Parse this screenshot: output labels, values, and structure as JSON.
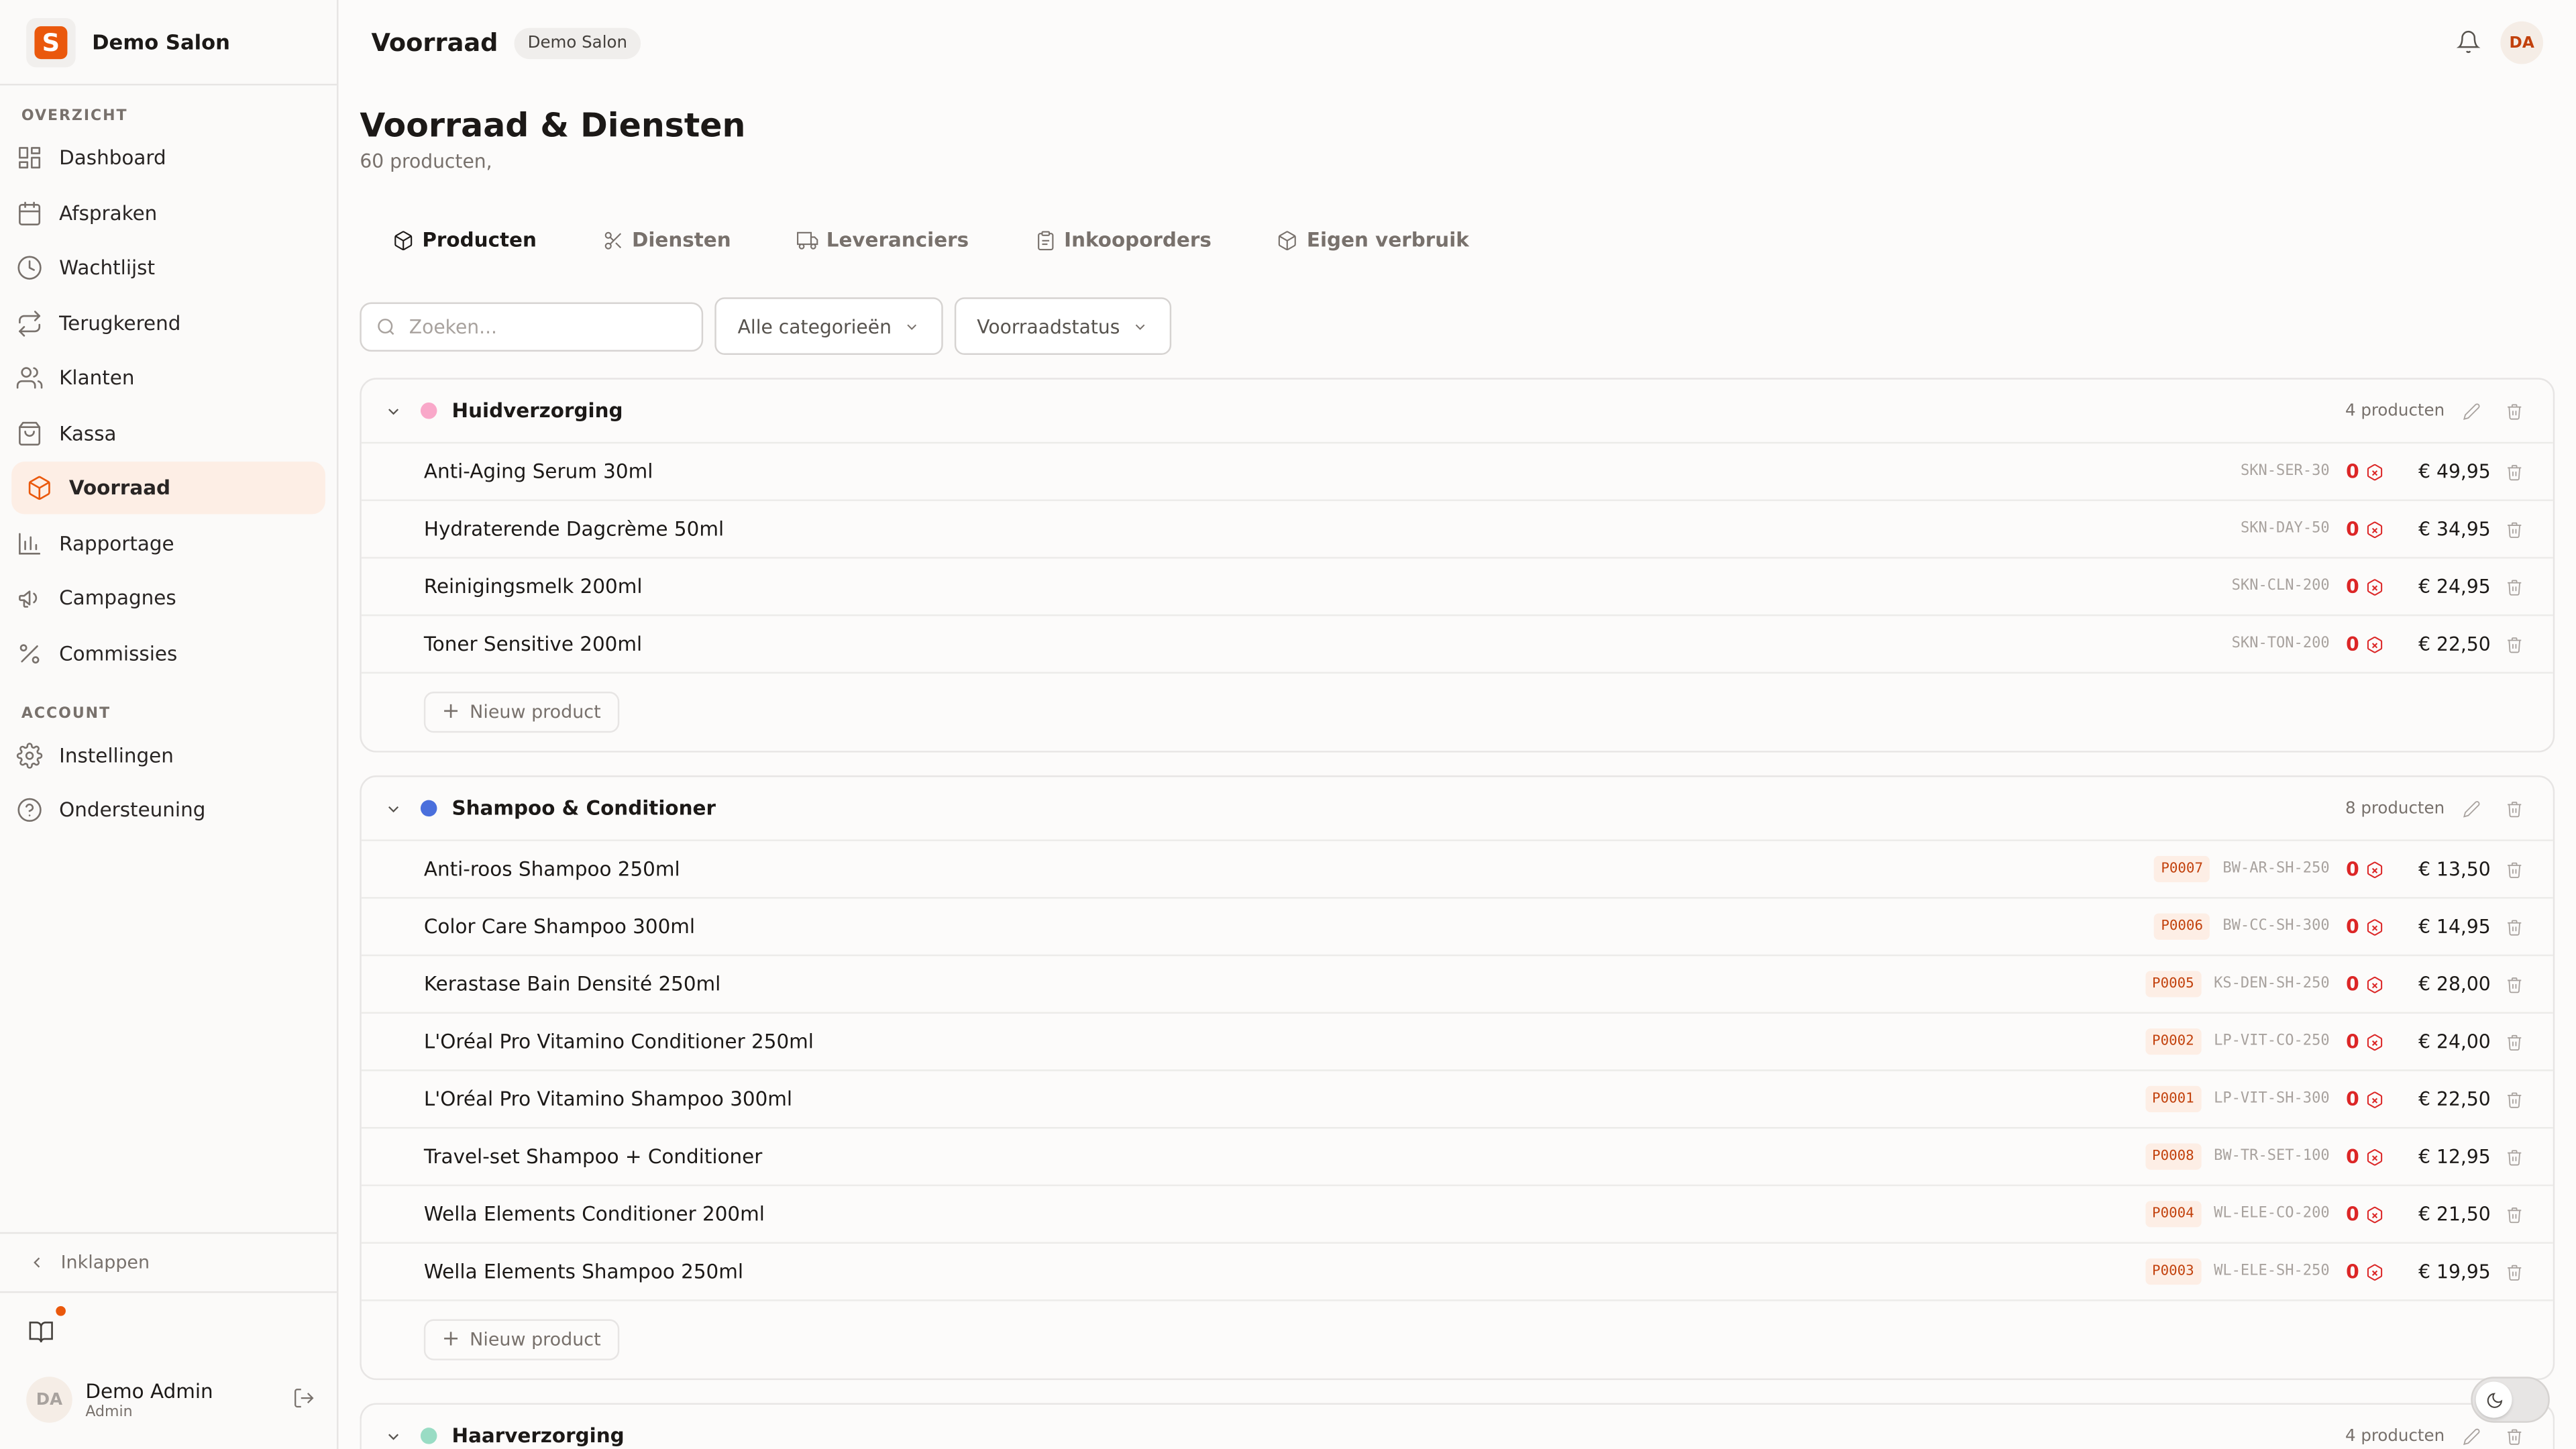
{
  "brand": {
    "logo_letter": "S",
    "name": "Demo Salon"
  },
  "sidebar": {
    "sections": [
      {
        "label": "OVERZICHT"
      },
      {
        "label": "ACCOUNT"
      }
    ],
    "items": [
      {
        "label": "Dashboard",
        "icon": "dashboard-icon"
      },
      {
        "label": "Afspraken",
        "icon": "calendar-icon"
      },
      {
        "label": "Wachtlijst",
        "icon": "clock-icon"
      },
      {
        "label": "Terugkerend",
        "icon": "repeat-icon"
      },
      {
        "label": "Klanten",
        "icon": "users-icon"
      },
      {
        "label": "Kassa",
        "icon": "shopping-bag-icon"
      },
      {
        "label": "Voorraad",
        "icon": "package-icon",
        "active": true
      },
      {
        "label": "Rapportage",
        "icon": "bar-chart-icon"
      },
      {
        "label": "Campagnes",
        "icon": "megaphone-icon"
      },
      {
        "label": "Commissies",
        "icon": "percent-icon"
      },
      {
        "label": "Instellingen",
        "icon": "gear-icon"
      },
      {
        "label": "Ondersteuning",
        "icon": "help-circle-icon"
      }
    ],
    "collapse_label": "Inklappen",
    "user": {
      "initials": "DA",
      "name": "Demo Admin",
      "role": "Admin"
    }
  },
  "header": {
    "title": "Voorraad",
    "badge": "Demo Salon",
    "avatar_initials": "DA"
  },
  "page": {
    "title": "Voorraad & Diensten",
    "subtitle": "60 producten,"
  },
  "tabs": [
    {
      "label": "Producten",
      "icon": "package-icon",
      "active": true
    },
    {
      "label": "Diensten",
      "icon": "scissors-icon"
    },
    {
      "label": "Leveranciers",
      "icon": "truck-icon"
    },
    {
      "label": "Inkooporders",
      "icon": "clipboard-icon"
    },
    {
      "label": "Eigen verbruik",
      "icon": "package-icon"
    }
  ],
  "filters": {
    "search_placeholder": "Zoeken...",
    "category": "Alle categorieën",
    "status": "Voorraadstatus"
  },
  "add_product_label": "Nieuw product",
  "groups": [
    {
      "name": "Huidverzorging",
      "color": "#f9a8c9",
      "count": "4 producten",
      "products": [
        {
          "name": "Anti-Aging Serum 30ml",
          "code": "",
          "sku": "SKN-SER-30",
          "stock": "0",
          "price": "€ 49,95"
        },
        {
          "name": "Hydraterende Dagcrème 50ml",
          "code": "",
          "sku": "SKN-DAY-50",
          "stock": "0",
          "price": "€ 34,95"
        },
        {
          "name": "Reinigingsmelk 200ml",
          "code": "",
          "sku": "SKN-CLN-200",
          "stock": "0",
          "price": "€ 24,95"
        },
        {
          "name": "Toner Sensitive 200ml",
          "code": "",
          "sku": "SKN-TON-200",
          "stock": "0",
          "price": "€ 22,50"
        }
      ]
    },
    {
      "name": "Shampoo & Conditioner",
      "color": "#4a6fdc",
      "count": "8 producten",
      "products": [
        {
          "name": "Anti-roos Shampoo 250ml",
          "code": "P0007",
          "sku": "BW-AR-SH-250",
          "stock": "0",
          "price": "€ 13,50"
        },
        {
          "name": "Color Care Shampoo 300ml",
          "code": "P0006",
          "sku": "BW-CC-SH-300",
          "stock": "0",
          "price": "€ 14,95"
        },
        {
          "name": "Kerastase Bain Densité 250ml",
          "code": "P0005",
          "sku": "KS-DEN-SH-250",
          "stock": "0",
          "price": "€ 28,00"
        },
        {
          "name": "L'Oréal Pro Vitamino Conditioner 250ml",
          "code": "P0002",
          "sku": "LP-VIT-CO-250",
          "stock": "0",
          "price": "€ 24,00"
        },
        {
          "name": "L'Oréal Pro Vitamino Shampoo 300ml",
          "code": "P0001",
          "sku": "LP-VIT-SH-300",
          "stock": "0",
          "price": "€ 22,50"
        },
        {
          "name": "Travel-set Shampoo + Conditioner",
          "code": "P0008",
          "sku": "BW-TR-SET-100",
          "stock": "0",
          "price": "€ 12,95"
        },
        {
          "name": "Wella Elements Conditioner 200ml",
          "code": "P0004",
          "sku": "WL-ELE-CO-200",
          "stock": "0",
          "price": "€ 21,50"
        },
        {
          "name": "Wella Elements Shampoo 250ml",
          "code": "P0003",
          "sku": "WL-ELE-SH-250",
          "stock": "0",
          "price": "€ 19,95"
        }
      ]
    },
    {
      "name": "Haarverzorging",
      "color": "#99dcc4",
      "count": "4 producten",
      "products": []
    }
  ],
  "colors": {
    "accent": "#ea580c",
    "stock_low": "#dc2626"
  }
}
